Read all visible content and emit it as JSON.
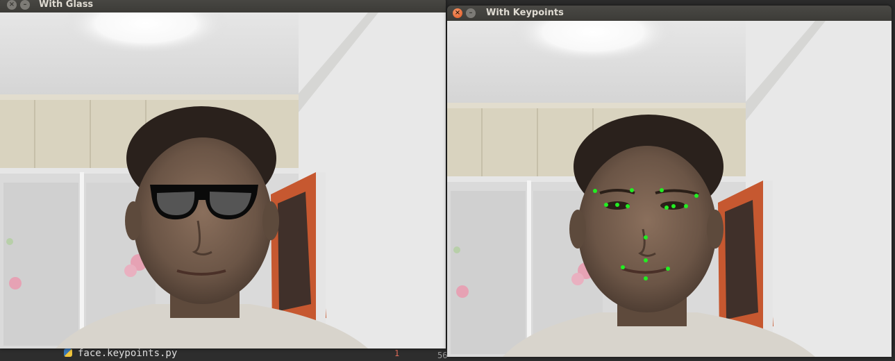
{
  "windows": [
    {
      "id": "glass",
      "title": "With Glass",
      "active": false
    },
    {
      "id": "keypoints",
      "title": "With Keypoints",
      "active": true
    }
  ],
  "editor": {
    "filename": "face.keypoints.py",
    "badge": "1",
    "line_number": "56"
  },
  "colors": {
    "keypoint": "#22ee22",
    "glasses_frame": "#0a0a0a",
    "glasses_lens": "#555555",
    "close_active": "#e0531e"
  },
  "icons": {
    "close": "close-icon",
    "minimize": "minimize-icon"
  }
}
